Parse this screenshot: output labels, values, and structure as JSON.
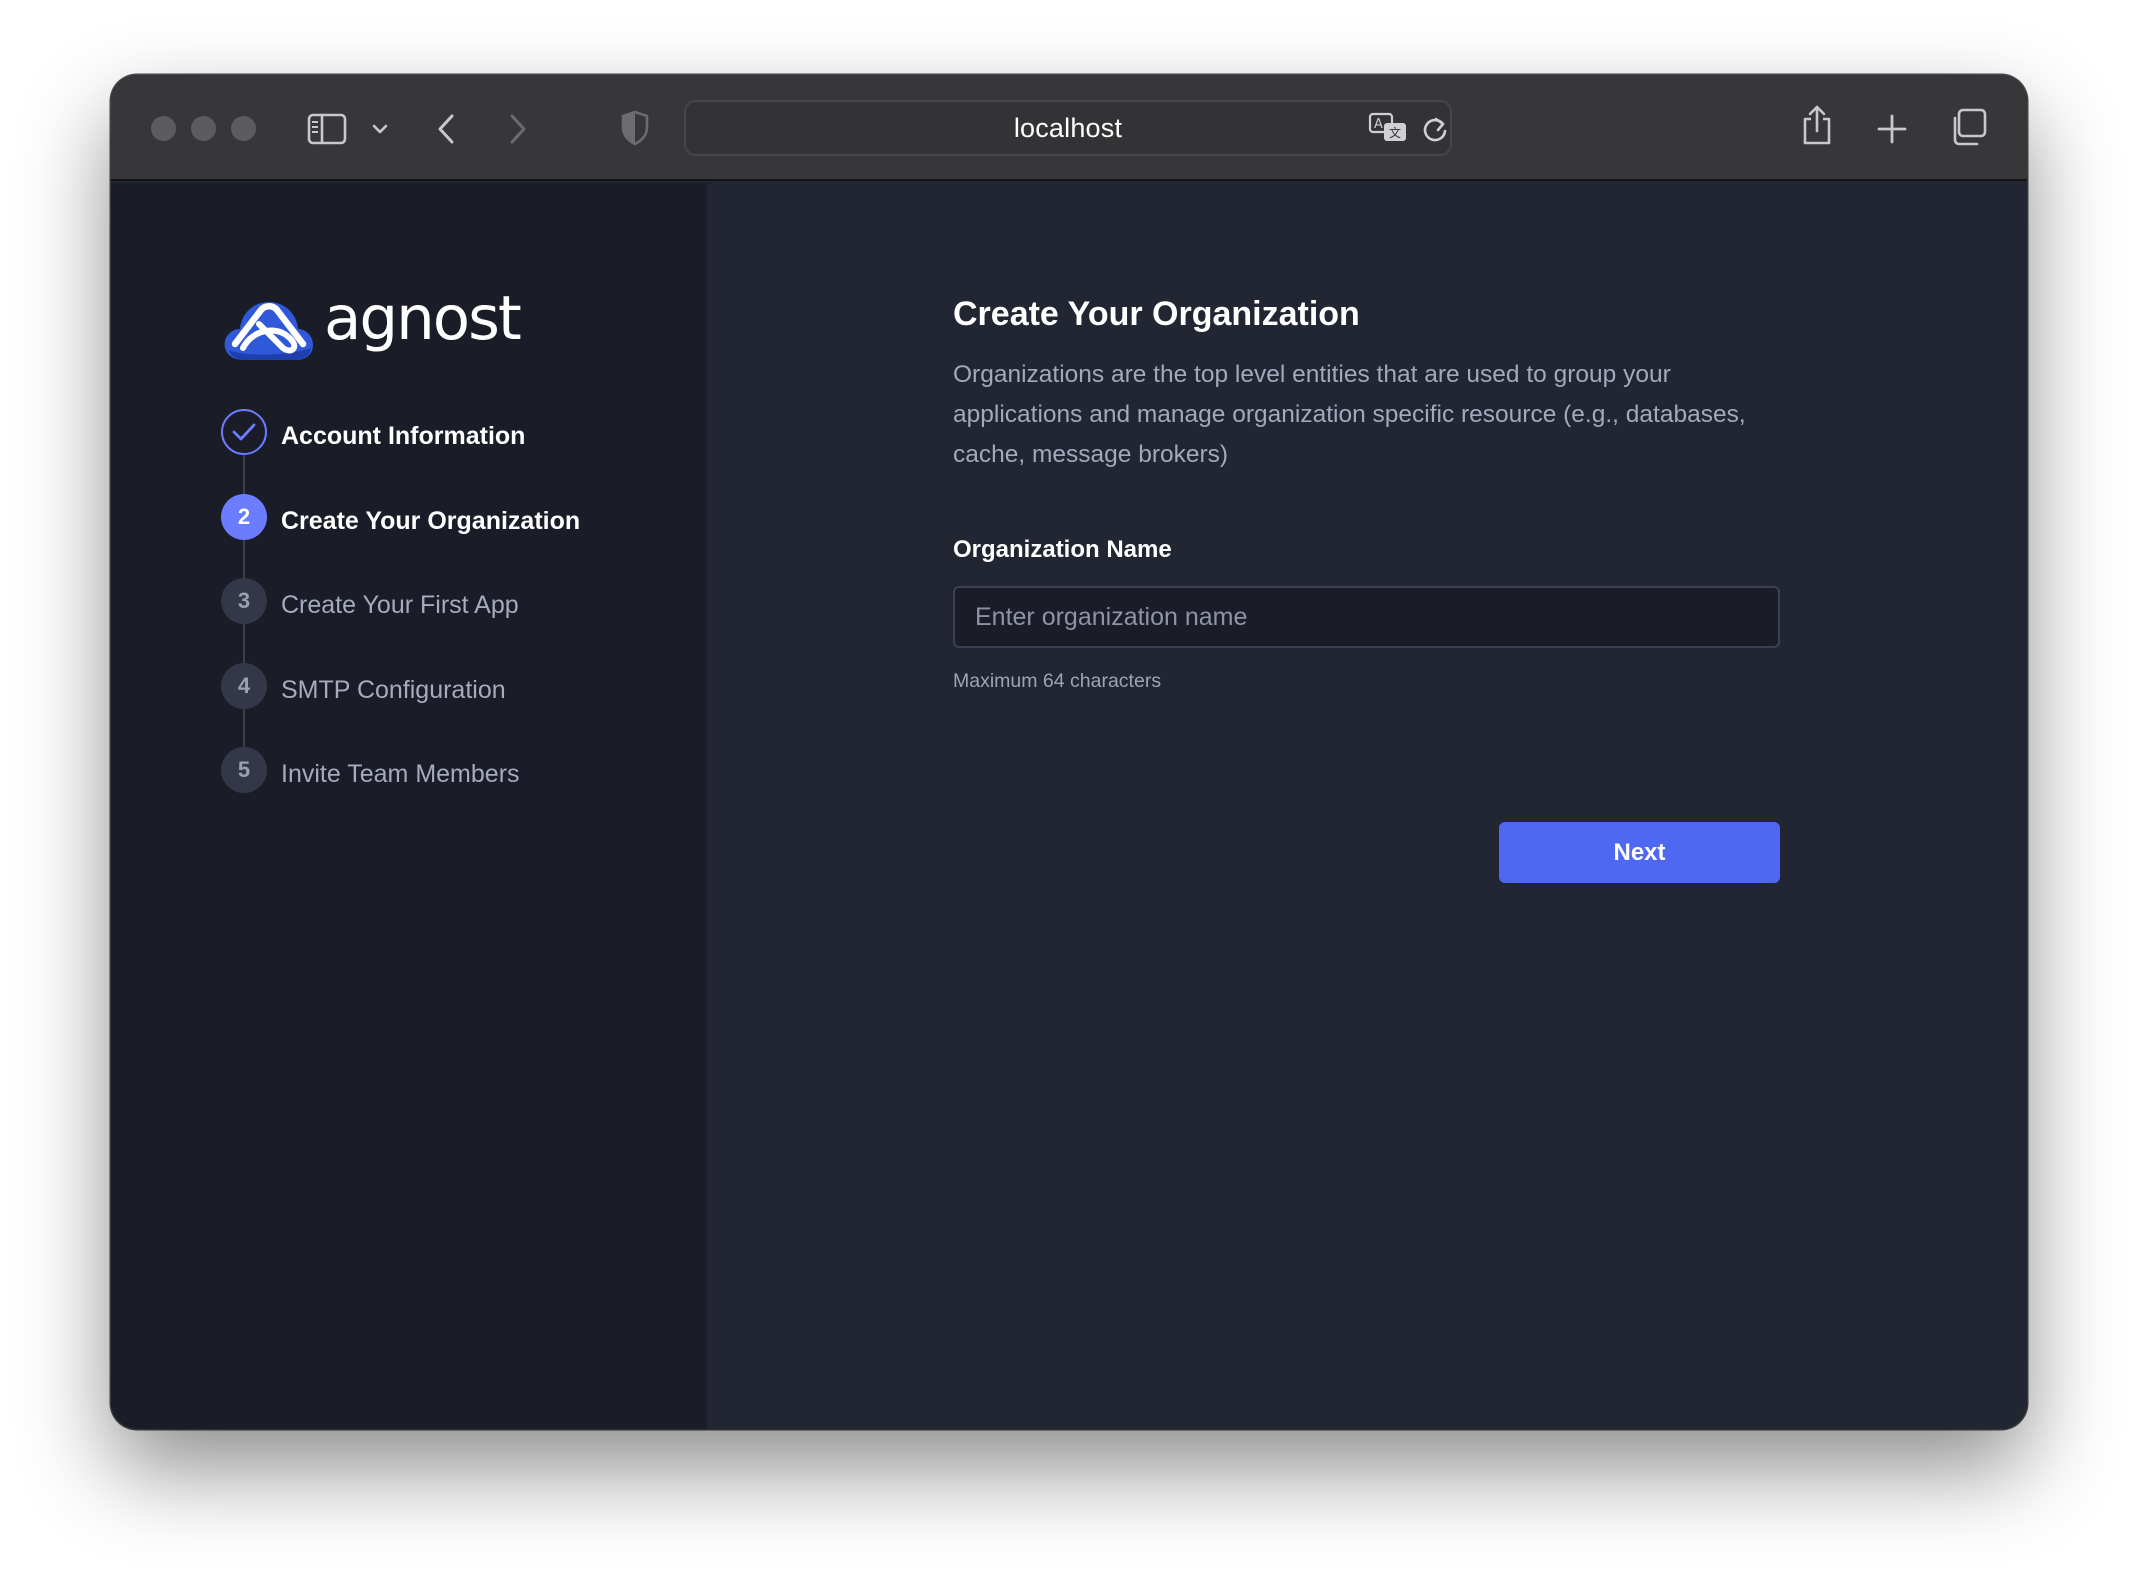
{
  "browser": {
    "url": "localhost"
  },
  "brand": {
    "name": "agnost",
    "accent": "#4e68f2"
  },
  "steps": [
    {
      "number": "1",
      "label": "Account Information",
      "state": "completed"
    },
    {
      "number": "2",
      "label": "Create Your Organization",
      "state": "active"
    },
    {
      "number": "3",
      "label": "Create Your First App",
      "state": "pending"
    },
    {
      "number": "4",
      "label": "SMTP Configuration",
      "state": "pending"
    },
    {
      "number": "5",
      "label": "Invite Team Members",
      "state": "pending"
    }
  ],
  "main": {
    "title": "Create Your Organization",
    "description": "Organizations are the top level entities that are used to group your applications and manage organization specific resource (e.g., databases, cache, message brokers)",
    "field_label": "Organization Name",
    "field_value": "",
    "field_placeholder": "Enter organization name",
    "field_hint": "Maximum 64 characters",
    "next_label": "Next"
  }
}
